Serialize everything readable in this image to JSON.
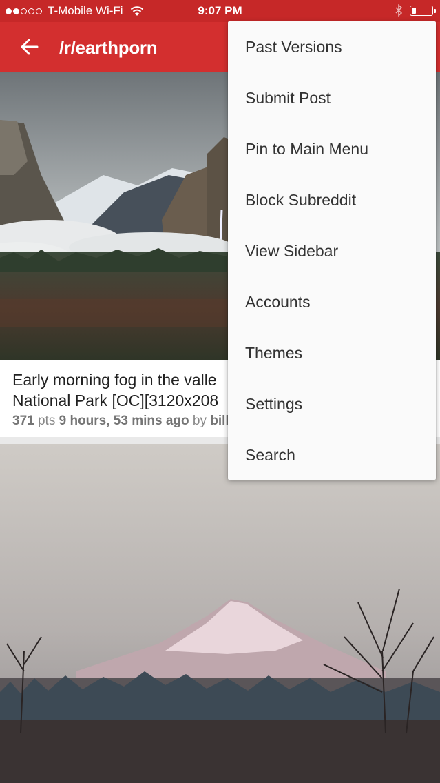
{
  "status_bar": {
    "carrier": "T-Mobile Wi-Fi",
    "time": "9:07 PM",
    "signal_dots_filled": 2,
    "signal_dots_total": 5,
    "battery_level": 0.2,
    "icons": [
      "wifi-icon",
      "bluetooth-icon",
      "battery-icon"
    ]
  },
  "toolbar": {
    "title": "/r/earthporn",
    "back_icon": "arrow-left-icon",
    "color": "#d32f2f"
  },
  "posts": [
    {
      "title_line1": "Early morning fog in the valle",
      "title_line2": "National Park [OC][3120x208",
      "points": "371",
      "points_unit": "pts",
      "age": "9 hours, 53 mins ago",
      "by_label": "by",
      "author": "billi"
    },
    {}
  ],
  "menu": {
    "items": [
      "Past Versions",
      "Submit Post",
      "Pin to Main Menu",
      "Block Subreddit",
      "View Sidebar",
      "Accounts",
      "Themes",
      "Settings",
      "Search"
    ]
  }
}
